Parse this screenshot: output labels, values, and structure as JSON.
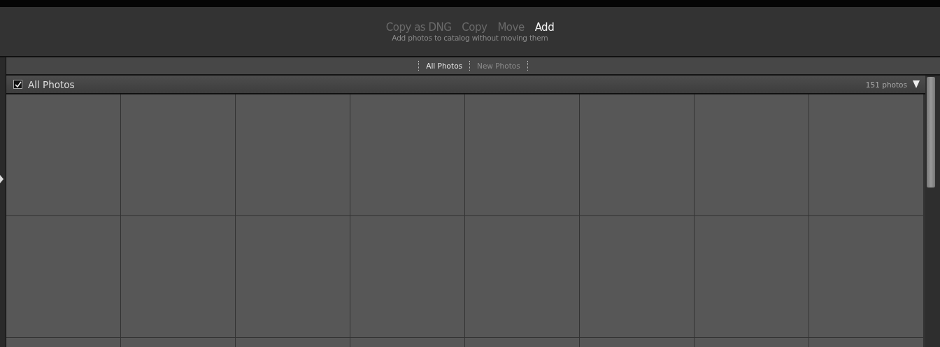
{
  "import_modes": [
    {
      "label": "Copy as DNG",
      "selected": false
    },
    {
      "label": "Copy",
      "selected": false
    },
    {
      "label": "Move",
      "selected": false
    },
    {
      "label": "Add",
      "selected": true
    }
  ],
  "mode_description": "Add photos to catalog without moving them",
  "filter_tabs": [
    {
      "label": "All Photos",
      "selected": true
    },
    {
      "label": "New Photos",
      "selected": false
    }
  ],
  "section": {
    "checked": true,
    "title": "All Photos",
    "count": "151 photos"
  }
}
